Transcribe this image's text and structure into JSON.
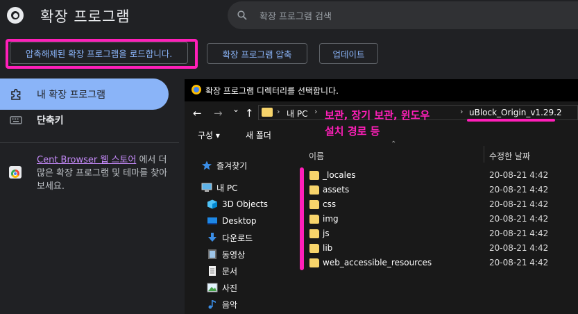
{
  "header": {
    "title": "확장 프로그램",
    "search_placeholder": "확장 프로그램 검색"
  },
  "toolbar": {
    "load_unpacked": "압축해제된 확장 프로그램을 로드합니다.",
    "pack": "확장 프로그램 압축",
    "update": "업데이트"
  },
  "sidebar": {
    "items": [
      {
        "label": "내 확장 프로그램",
        "icon": "puzzle-icon"
      },
      {
        "label": "단축키",
        "icon": "keyboard-icon"
      }
    ],
    "store_link": "Cent Browser 웹 스토어",
    "store_rest": " 에서 더 많은 확장 프로그램 및 테마를 찾아보세요."
  },
  "dialog": {
    "title": "확장 프로그램 디렉터리를 선택합니다.",
    "nav": {
      "back": "←",
      "forward": "→",
      "recent": "⌄",
      "up": "↑"
    },
    "address": [
      "내 PC",
      "보관, 장기 보관, 윈도우",
      "uBlock_Origin_v1.29.2"
    ],
    "commands": {
      "organize": "구성 ▾",
      "new_folder": "새 폴더"
    },
    "nav_pane": [
      {
        "label": "즐겨찾기",
        "icon": "star-icon"
      },
      {
        "label": "내 PC",
        "icon": "pc-icon"
      },
      {
        "label": "3D Objects",
        "icon": "cube-icon"
      },
      {
        "label": "Desktop",
        "icon": "desktop-icon"
      },
      {
        "label": "다운로드",
        "icon": "download-icon"
      },
      {
        "label": "동영상",
        "icon": "video-icon"
      },
      {
        "label": "문서",
        "icon": "document-icon"
      },
      {
        "label": "사진",
        "icon": "picture-icon"
      },
      {
        "label": "음악",
        "icon": "music-icon"
      }
    ],
    "columns": {
      "name": "이름",
      "modified": "수정한 날짜"
    },
    "files": [
      {
        "name": "_locales",
        "date": "20-08-21  4:42"
      },
      {
        "name": "assets",
        "date": "20-08-21  4:42"
      },
      {
        "name": "css",
        "date": "20-08-21  4:42"
      },
      {
        "name": "img",
        "date": "20-08-21  4:42"
      },
      {
        "name": "js",
        "date": "20-08-21  4:42"
      },
      {
        "name": "lib",
        "date": "20-08-21  4:42"
      },
      {
        "name": "web_accessible_resources",
        "date": "20-08-21  4:42"
      }
    ]
  },
  "annotation": {
    "line1": "보관, 장기 보관, 윈도우",
    "line2": "설치 경로 등",
    "color": "#ff1fb9"
  }
}
